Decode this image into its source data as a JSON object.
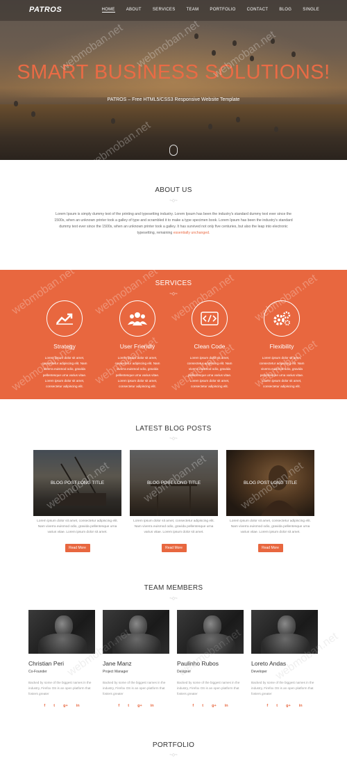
{
  "nav": {
    "logo": "PATROS",
    "items": [
      "HOME",
      "ABOUT",
      "SERVICES",
      "TEAM",
      "PORTFOLIO",
      "CONTACT",
      "BLOG",
      "SINGLE"
    ]
  },
  "hero": {
    "title": "SMART BUSINESS SOLUTIONS!",
    "subtitle": "PATROS – Free HTML5/CSS3 Responsive Website Template"
  },
  "about": {
    "title": "ABOUT US",
    "text": "Lorem Ipsum is simply dummy text of the printing and typesetting industry. Lorem Ipsum has been the industry's standard dummy text ever since the 1500s, when an unknown printer took a galley of type and scrambled it to make a type specimen book. Lorem Ipsum has been the industry's standard dummy text ever since the 1500s, when an unknown printer took a galley. It has survived not only five centuries, but also the leap into electronic typesetting, remaining ",
    "highlight": "essentially unchanged."
  },
  "services": {
    "title": "SERVICES",
    "items": [
      {
        "icon": "chart-icon",
        "name": "Strategy",
        "desc": "Lorem ipsum dolor sit amet, consectetur adipiscing elit. Nam viverra euismod odio, gravida pellentesque urna varius vitae. Lorem ipsum dolor sit amet, consectetur adipiscing elit."
      },
      {
        "icon": "users-icon",
        "name": "User Friendly",
        "desc": "Lorem ipsum dolor sit amet, consectetur adipiscing elit. Nam viverra euismod odio, gravida pellentesque urna varius vitae. Lorem ipsum dolor sit amet, consectetur adipiscing elit."
      },
      {
        "icon": "code-icon",
        "name": "Clean Code",
        "desc": "Lorem ipsum dolor sit amet, consectetur adipiscing elit. Nam viverra euismod odio, gravida pellentesque urna varius vitae. Lorem ipsum dolor sit amet, consectetur adipiscing elit."
      },
      {
        "icon": "gears-icon",
        "name": "Flexibility",
        "desc": "Lorem ipsum dolor sit amet, consectetur adipiscing elit. Nam viverra euismod odio, gravida pellentesque urna varius vitae. Lorem ipsum dolor sit amet, consectetur adipiscing elit."
      }
    ]
  },
  "blog": {
    "title": "LATEST BLOG POSTS",
    "posts": [
      {
        "title": "BLOG POST LONG TITLE",
        "desc": "Lorem ipsum dolor sit amet, consectetur adipiscing elit. Nam viverra euismod odio, gravida pellentesque urna varius vitae. Lorem ipsum dolor sit amet.",
        "button": "Read More"
      },
      {
        "title": "BLOG POST LONG TITLE",
        "desc": "Lorem ipsum dolor sit amet, consectetur adipiscing elit. Nam viverra euismod odio, gravida pellentesque urna varius vitae. Lorem ipsum dolor sit amet.",
        "button": "Read More"
      },
      {
        "title": "BLOG POST LONG TITLE",
        "desc": "Lorem ipsum dolor sit amet, consectetur adipiscing elit. Nam viverra euismod odio, gravida pellentesque urna varius vitae. Lorem ipsum dolor sit amet.",
        "button": "Read More"
      }
    ]
  },
  "team": {
    "title": "TEAM MEMBERS",
    "members": [
      {
        "name": "Christian Peri",
        "role": "Co-Founder",
        "desc": "Backed by some of the biggest names in the industry, Firefox OS is an open platform that fosters greater"
      },
      {
        "name": "Jane Manz",
        "role": "Project Manager",
        "desc": "Backed by some of the biggest names in the industry, Firefox OS is an open platform that fosters greater"
      },
      {
        "name": "Paulinho Rubos",
        "role": "Designer",
        "desc": "Backed by some of the biggest names in the industry, Firefox OS is an open platform that fosters greater"
      },
      {
        "name": "Loreto Andas",
        "role": "Developer",
        "desc": "Backed by some of the biggest names in the industry, Firefox OS is an open platform that fosters greater"
      }
    ],
    "social": [
      "f",
      "t",
      "g+",
      "in"
    ]
  },
  "portfolio": {
    "title": "PORTFOLIO"
  },
  "watermark": "webmoban.net",
  "colors": {
    "accent": "#e8673f",
    "hero_title": "#ea6b45"
  }
}
